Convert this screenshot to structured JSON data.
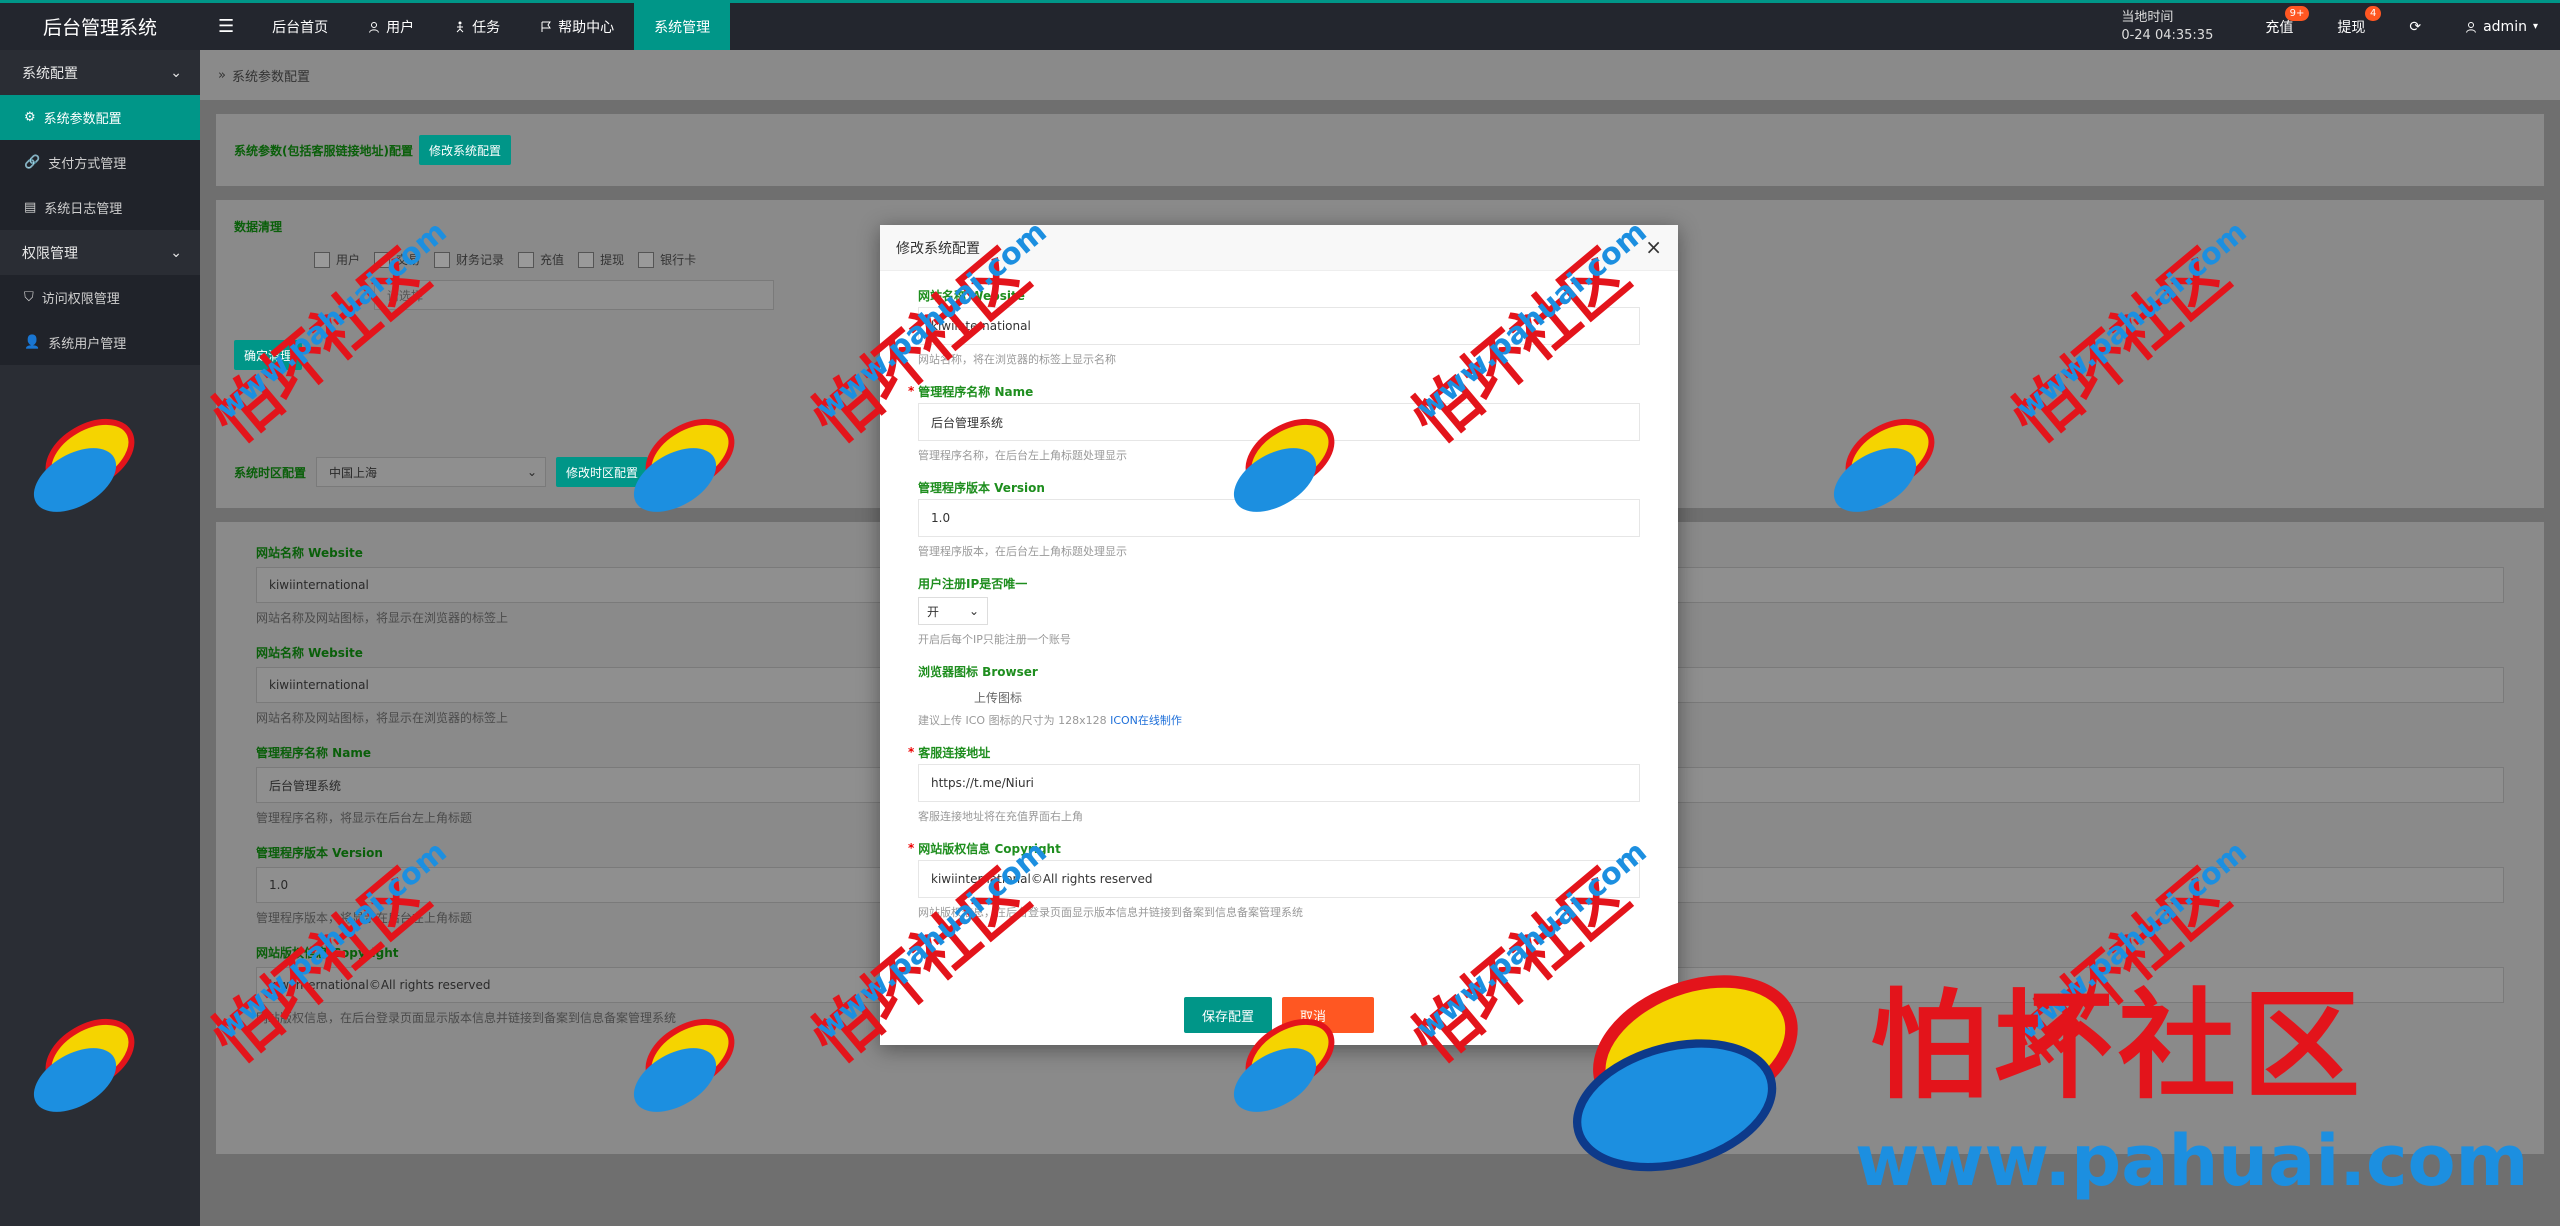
{
  "app": {
    "title": "后台管理系统"
  },
  "topnav": {
    "menu_icon": "☰",
    "items": [
      {
        "label": "后台首页",
        "icon": ""
      },
      {
        "label": "用户",
        "icon": "user-icon"
      },
      {
        "label": "任务",
        "icon": "task-icon"
      },
      {
        "label": "帮助中心",
        "icon": "flag-icon"
      },
      {
        "label": "系统管理",
        "icon": "",
        "active": true
      }
    ]
  },
  "topright": {
    "time_label": "当地时间",
    "time_value": "0-24 04:35:35",
    "recharge": {
      "label": "充值",
      "badge": "9+"
    },
    "withdraw": {
      "label": "提现",
      "badge": "4"
    },
    "user": "admin"
  },
  "sidebar": {
    "groups": [
      {
        "label": "系统配置",
        "items": [
          {
            "label": "系统参数配置",
            "active": true
          },
          {
            "label": "支付方式管理"
          },
          {
            "label": "系统日志管理"
          }
        ]
      },
      {
        "label": "权限管理",
        "items": [
          {
            "label": "访问权限管理"
          },
          {
            "label": "系统用户管理"
          }
        ]
      }
    ]
  },
  "breadcrumb": "系统参数配置",
  "main": {
    "sys_param_label": "系统参数(包括客服链接地址)配置",
    "sys_param_button": "修改系统配置",
    "clean_label": "数据清理",
    "clean_options": [
      "用户",
      "交易",
      "财务记录",
      "充值",
      "提现",
      "银行卡"
    ],
    "clean_placeholder": "请选择",
    "clean_button": "确定清理",
    "tz_label": "系统时区配置",
    "tz_value": "中国上海",
    "tz_button": "修改时区配置",
    "fields": [
      {
        "label": "网站名称 Website",
        "value": "kiwiinternational",
        "hint": "网站名称及网站图标，将显示在浏览器的标签上"
      },
      {
        "label": "网站名称 Website",
        "value": "kiwiinternational",
        "hint": "网站名称及网站图标，将显示在浏览器的标签上"
      },
      {
        "label": "管理程序名称 Name",
        "value": "后台管理系统",
        "hint": "管理程序名称，将显示在后台左上角标题"
      },
      {
        "label": "管理程序版本 Version",
        "value": "1.0",
        "hint": "管理程序版本，将显示在后台左上角标题"
      },
      {
        "label": "网站版权信息 Copyright",
        "value": "kiwiinternational©All rights reserved",
        "hint": "网站版权信息，在后台登录页面显示版本信息并链接到备案到信息备案管理系统"
      }
    ]
  },
  "modal": {
    "title": "修改系统配置",
    "close_icon": "×",
    "fields": [
      {
        "label": "网站名称 Website",
        "value": "kiwiinternational",
        "hint": "网站名称，将在浏览器的标签上显示名称",
        "required": false
      },
      {
        "label": "管理程序名称 Name",
        "value": "后台管理系统",
        "hint": "管理程序名称，在后台左上角标题处理显示",
        "required": true
      },
      {
        "label": "管理程序版本 Version",
        "value": "1.0",
        "hint": "管理程序版本，在后台左上角标题处理显示",
        "required": false
      }
    ],
    "ip_label": "用户注册IP是否唯一",
    "ip_value": "开",
    "ip_hint": "开启后每个IP只能注册一个账号",
    "icon_label": "浏览器图标 Browser",
    "icon_upload": "上传图标",
    "icon_hint": "建议上传 ICO 图标的尺寸为 128x128",
    "icon_link": "ICON在线制作",
    "service_label": "客服连接地址",
    "service_value": "https://t.me/Niuri",
    "service_hint": "客服连接地址将在充值界面右上角",
    "copyright_label": "网站版权信息 Copyright",
    "copyright_value": "kiwiinternational©All rights reserved",
    "copyright_hint": "网站版权信息，在后台登录页面显示版本信息并链接到备案到信息备案管理系统",
    "save_button": "保存配置",
    "cancel_button": "取消"
  },
  "watermark": {
    "title": "怕坏社区",
    "url": "www.pahuai.com"
  }
}
